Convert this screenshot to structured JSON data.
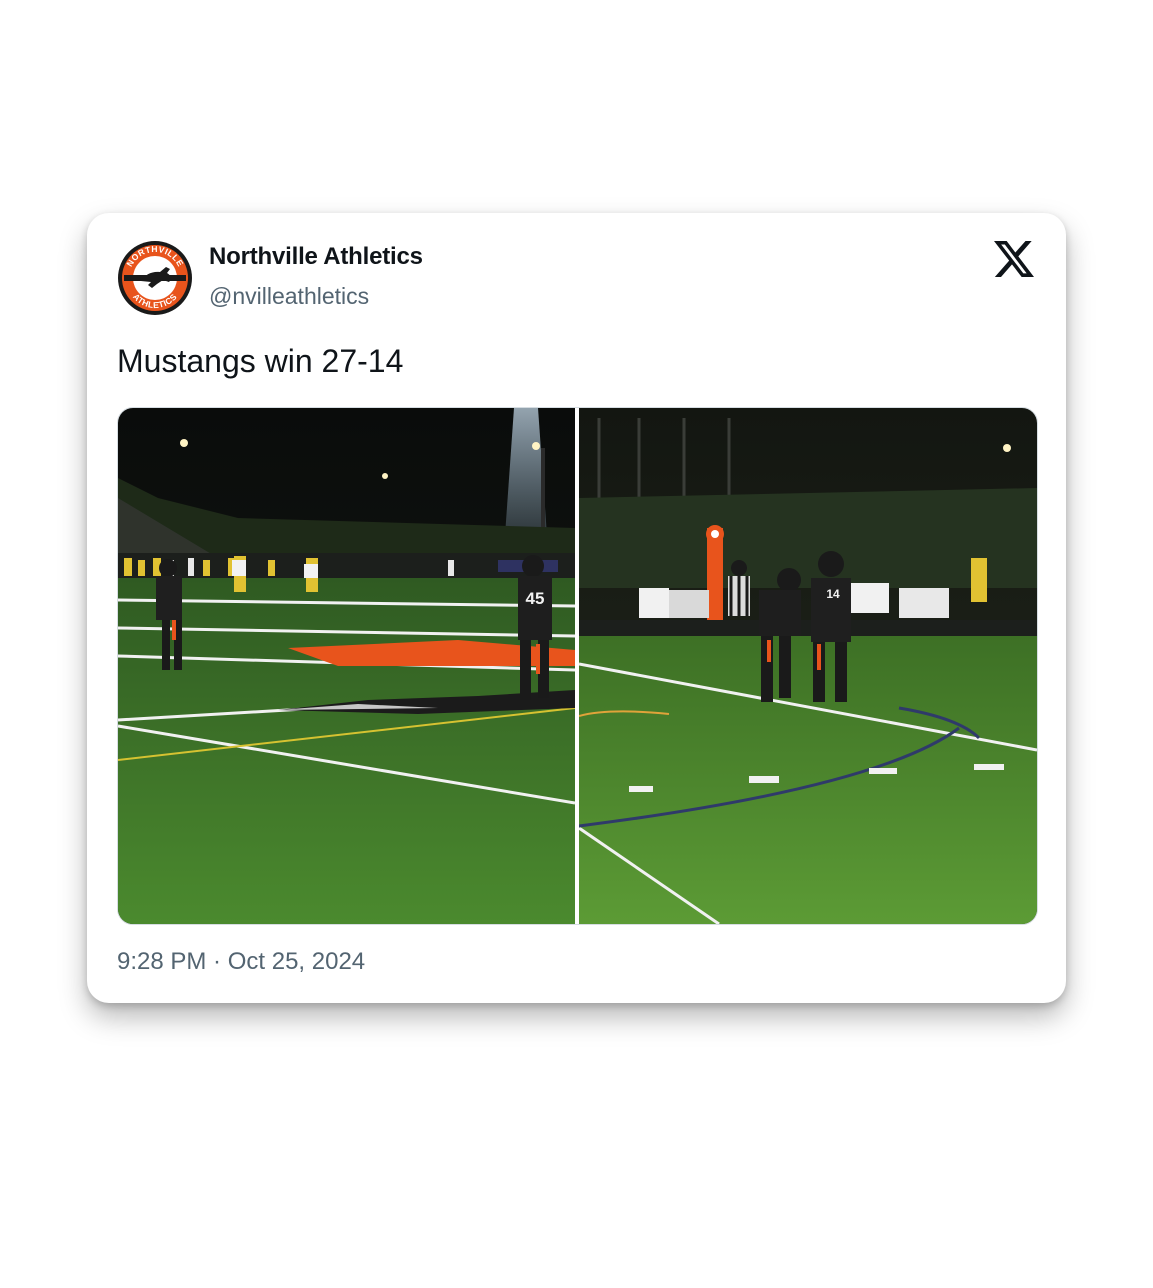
{
  "author": {
    "display_name": "Northville Athletics",
    "handle": "@nvilleathletics",
    "avatar_icon": "northville-athletics-logo",
    "avatar_text_top": "NORTHVILLE",
    "avatar_text_bottom": "ATHLETICS"
  },
  "platform_icon": "x-logo-icon",
  "tweet": {
    "text": "Mustangs win 27-14"
  },
  "media": {
    "photos": [
      {
        "jersey_number": "45"
      },
      {
        "jersey_number": "14"
      }
    ]
  },
  "timestamp": {
    "time": "9:28 PM",
    "separator": " · ",
    "date": "Oct 25, 2024"
  },
  "colors": {
    "brand_orange": "#e8541c",
    "text_primary": "#0f1419",
    "text_secondary": "#536471"
  }
}
